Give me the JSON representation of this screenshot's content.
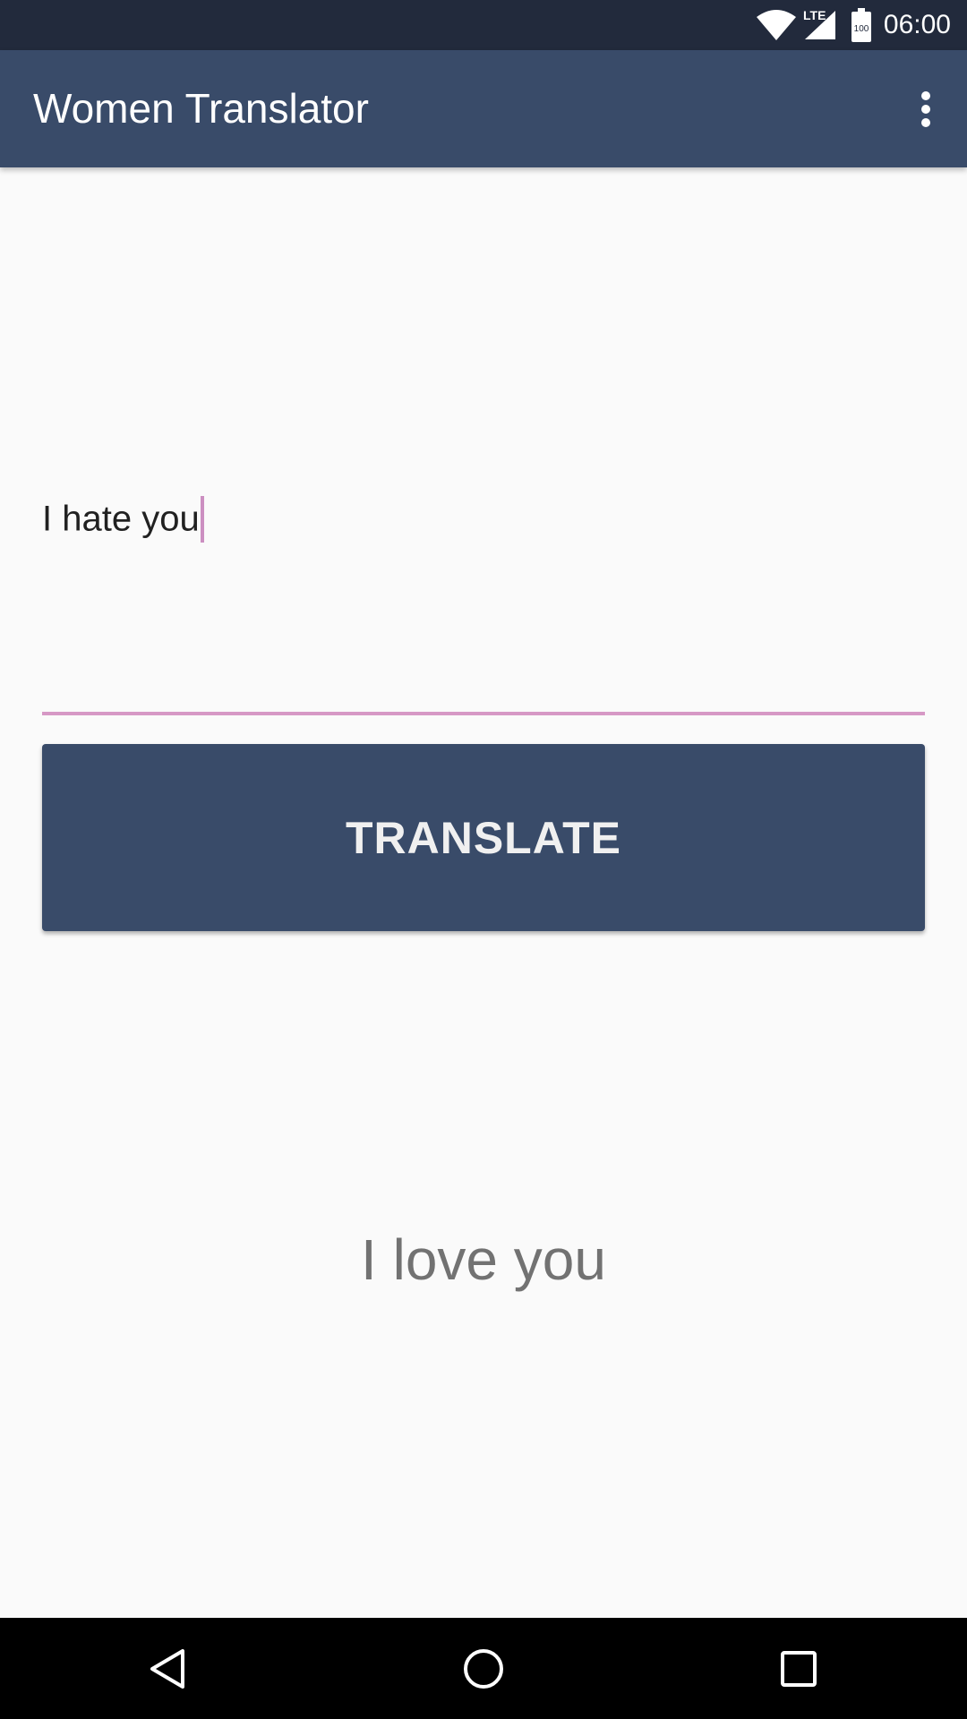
{
  "status_bar": {
    "time": "06:00",
    "network_label": "LTE",
    "battery_label": "100",
    "icons": [
      "wifi-icon",
      "signal-icon",
      "battery-icon"
    ]
  },
  "app_bar": {
    "title": "Women Translator",
    "menu_icon": "more-vert-icon"
  },
  "input": {
    "value": "I hate you",
    "accent_color": "#d698c5"
  },
  "translate_button": {
    "label": "TRANSLATE"
  },
  "output": {
    "text": "I love you"
  },
  "nav_bar": {
    "icons": [
      "back-icon",
      "home-icon",
      "recents-icon"
    ]
  },
  "colors": {
    "primary": "#394b69",
    "status_bar": "#222a3c",
    "background": "#fafafa",
    "accent": "#d698c5",
    "output_text": "#727272"
  }
}
